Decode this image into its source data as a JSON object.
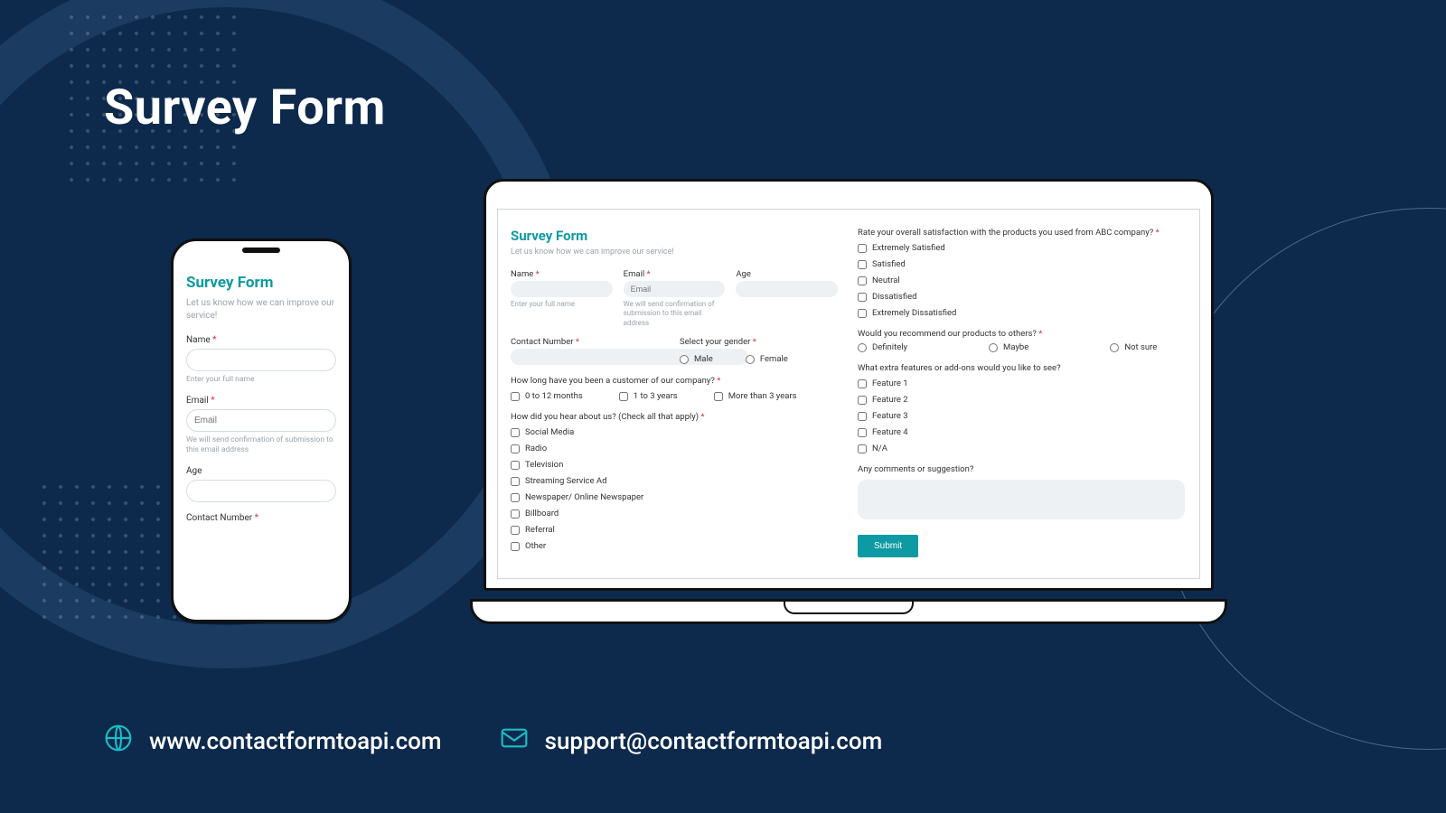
{
  "pageTitle": "Survey Form",
  "footer": {
    "website": "www.contactformtoapi.com",
    "email": "support@contactformtoapi.com"
  },
  "form": {
    "title": "Survey Form",
    "subtitle": "Let us know how we can improve our service!",
    "fields": {
      "name": {
        "label": "Name",
        "hint": "Enter your full name"
      },
      "email": {
        "label": "Email",
        "placeholder": "Email",
        "hint": "We will send confirmation of submission to this email address"
      },
      "age": {
        "label": "Age"
      },
      "contact": {
        "label": "Contact Number"
      },
      "gender": {
        "label": "Select your gender",
        "options": [
          "Male",
          "Female"
        ]
      }
    },
    "duration": {
      "label": "How long have you been a customer of our company?",
      "options": [
        "0 to 12 months",
        "1 to 3 years",
        "More than 3 years"
      ]
    },
    "hearAbout": {
      "label": "How did you hear about us? (Check all that apply)",
      "options": [
        "Social Media",
        "Radio",
        "Television",
        "Streaming Service Ad",
        "Newspaper/ Online Newspaper",
        "Billboard",
        "Referral",
        "Other"
      ]
    },
    "satisfaction": {
      "label": "Rate your overall satisfaction with the products you used from ABC company?",
      "options": [
        "Extremely Satisfied",
        "Satisfied",
        "Neutral",
        "Dissatisfied",
        "Extremely Dissatisfied"
      ]
    },
    "recommend": {
      "label": "Would you recommend our products to others?",
      "options": [
        "Definitely",
        "Maybe",
        "Not sure"
      ]
    },
    "features": {
      "label": "What extra features or add-ons would you like to see?",
      "options": [
        "Feature 1",
        "Feature 2",
        "Feature 3",
        "Feature 4",
        "N/A"
      ]
    },
    "comments": {
      "label": "Any comments or suggestion?"
    },
    "submit": "Submit"
  }
}
